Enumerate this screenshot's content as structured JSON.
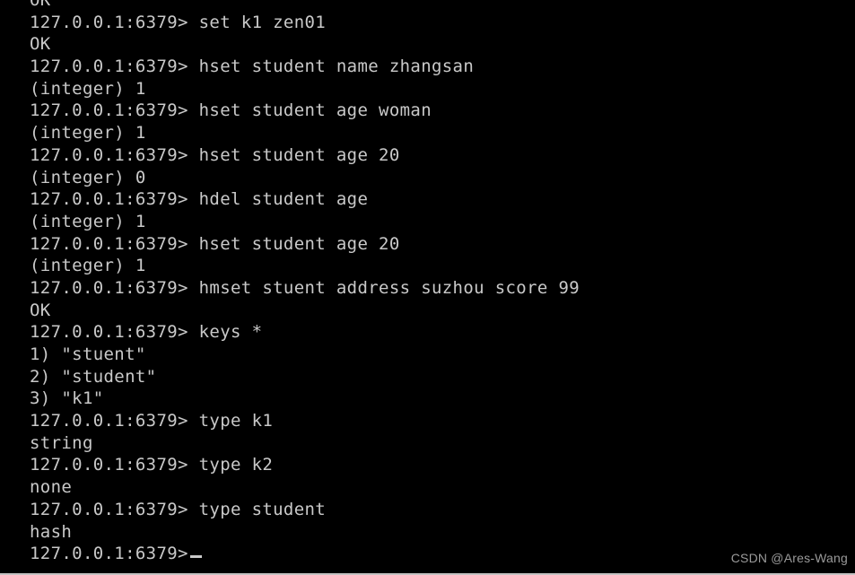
{
  "terminal": {
    "prompt": "127.0.0.1:6379>",
    "cursor_glyph": "_",
    "background_color": "#000000",
    "text_color": "#c9c9c9",
    "lines": [
      {
        "text": "OK",
        "kind": "output",
        "clipped": true
      },
      {
        "text": "127.0.0.1:6379> set k1 zen01",
        "kind": "command"
      },
      {
        "text": "OK",
        "kind": "output"
      },
      {
        "text": "127.0.0.1:6379> hset student name zhangsan",
        "kind": "command"
      },
      {
        "text": "(integer) 1",
        "kind": "output"
      },
      {
        "text": "127.0.0.1:6379> hset student age woman",
        "kind": "command"
      },
      {
        "text": "(integer) 1",
        "kind": "output"
      },
      {
        "text": "127.0.0.1:6379> hset student age 20",
        "kind": "command"
      },
      {
        "text": "(integer) 0",
        "kind": "output"
      },
      {
        "text": "127.0.0.1:6379> hdel student age",
        "kind": "command"
      },
      {
        "text": "(integer) 1",
        "kind": "output"
      },
      {
        "text": "127.0.0.1:6379> hset student age 20",
        "kind": "command"
      },
      {
        "text": "(integer) 1",
        "kind": "output"
      },
      {
        "text": "127.0.0.1:6379> hmset stuent address suzhou score 99",
        "kind": "command"
      },
      {
        "text": "OK",
        "kind": "output"
      },
      {
        "text": "127.0.0.1:6379> keys *",
        "kind": "command"
      },
      {
        "text": "1) \"stuent\"",
        "kind": "output"
      },
      {
        "text": "2) \"student\"",
        "kind": "output"
      },
      {
        "text": "3) \"k1\"",
        "kind": "output"
      },
      {
        "text": "127.0.0.1:6379> type k1",
        "kind": "command"
      },
      {
        "text": "string",
        "kind": "output"
      },
      {
        "text": "127.0.0.1:6379> type k2",
        "kind": "command"
      },
      {
        "text": "none",
        "kind": "output"
      },
      {
        "text": "127.0.0.1:6379> type student",
        "kind": "command"
      },
      {
        "text": "hash",
        "kind": "output"
      }
    ],
    "final_prompt_line": "127.0.0.1:6379>"
  },
  "watermark": {
    "text": "CSDN @Ares-Wang",
    "color": "#9a9a9a"
  }
}
